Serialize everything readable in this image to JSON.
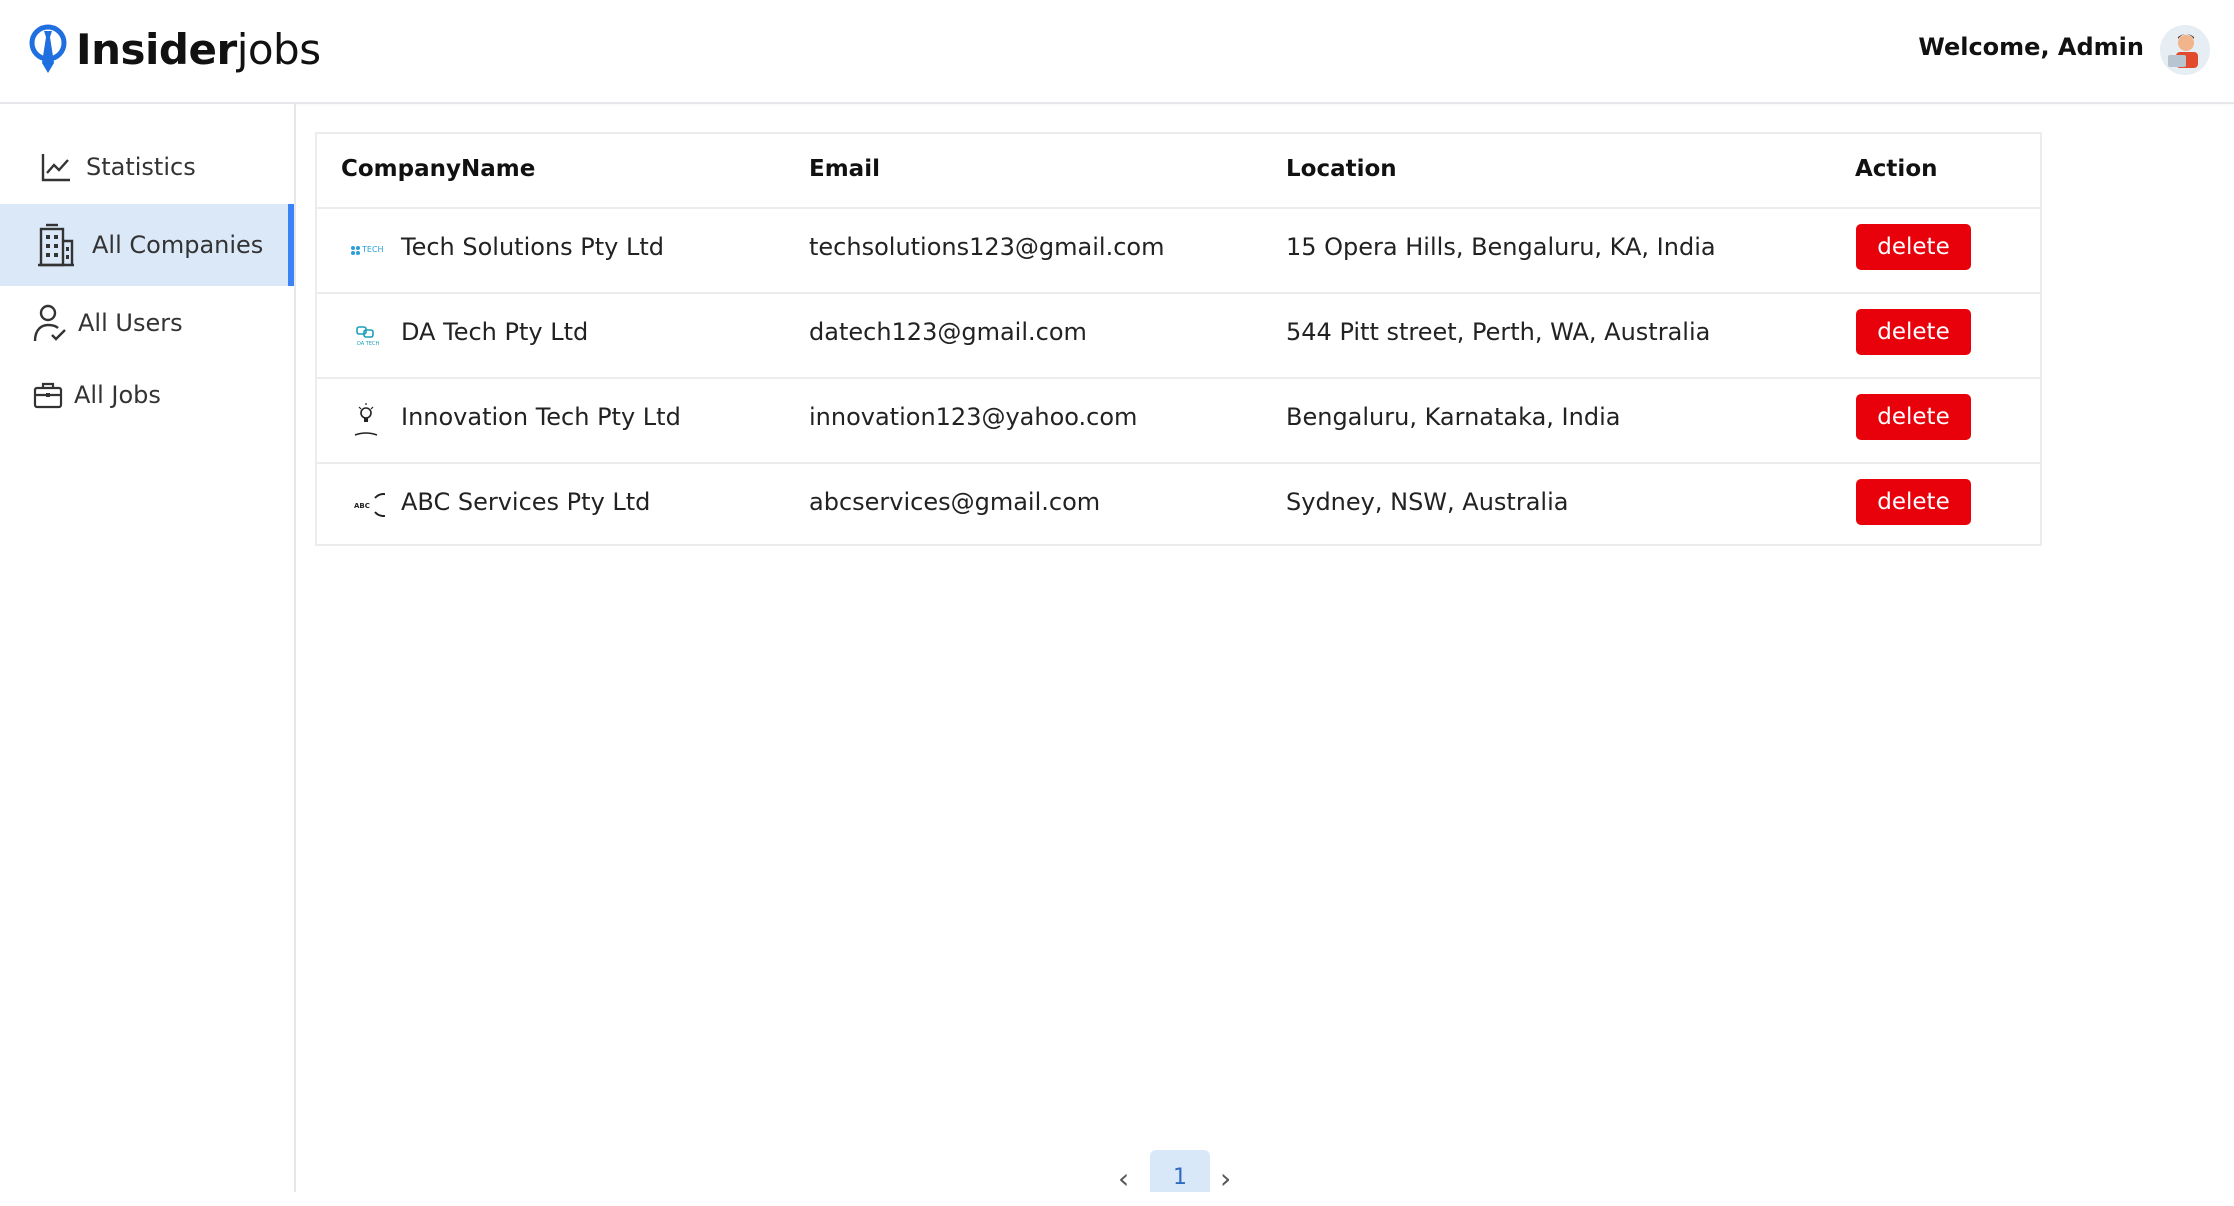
{
  "header": {
    "logo_bold": "Insider",
    "logo_light": "jobs",
    "welcome": "Welcome, Admin"
  },
  "sidebar": {
    "items": [
      {
        "label": "Statistics",
        "icon": "chart-line-icon",
        "active": false
      },
      {
        "label": "All Companies",
        "icon": "building-icon",
        "active": true
      },
      {
        "label": "All Users",
        "icon": "user-check-icon",
        "active": false
      },
      {
        "label": "All Jobs",
        "icon": "briefcase-icon",
        "active": false
      }
    ]
  },
  "table": {
    "columns": [
      "CompanyName",
      "Email",
      "Location",
      "Action"
    ],
    "rows": [
      {
        "name": "Tech Solutions Pty Ltd",
        "email": "techsolutions123@gmail.com",
        "location": "15 Opera Hills, Bengaluru, KA, India",
        "action": "delete"
      },
      {
        "name": "DA Tech Pty Ltd",
        "email": "datech123@gmail.com",
        "location": "544 Pitt street, Perth, WA, Australia",
        "action": "delete"
      },
      {
        "name": "Innovation Tech Pty Ltd",
        "email": "innovation123@yahoo.com",
        "location": "Bengaluru, Karnataka, India",
        "action": "delete"
      },
      {
        "name": "ABC Services Pty Ltd",
        "email": "abcservices@gmail.com",
        "location": "Sydney, NSW, Australia",
        "action": "delete"
      }
    ]
  },
  "pagination": {
    "current_page": "1",
    "prev": "‹",
    "next": "›"
  },
  "colors": {
    "accent": "#3b82f6",
    "active_bg": "#dbe8f8",
    "delete_button": "#e8000b"
  }
}
